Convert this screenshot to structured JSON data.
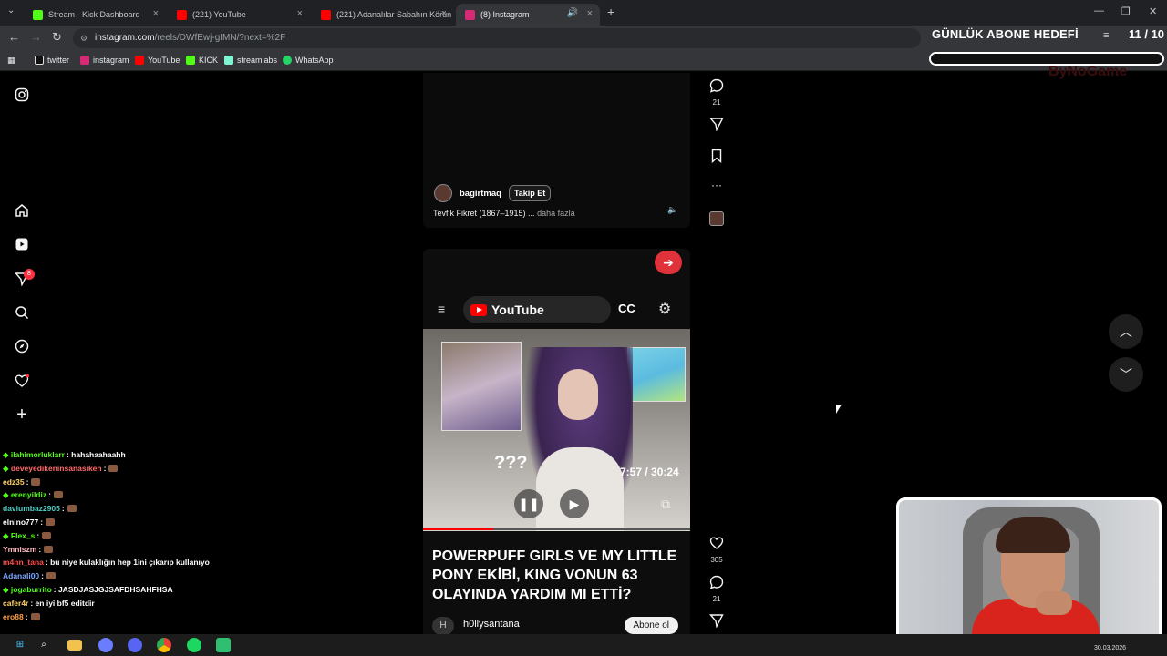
{
  "tabs": [
    {
      "label": "Stream - Kick Dashboard",
      "color": "#53fc18"
    },
    {
      "label": "(221) YouTube",
      "color": "#ff0000"
    },
    {
      "label": "(221) Adanalılar Sabahın Körün",
      "color": "#ff0000"
    },
    {
      "label": "(8) Instagram",
      "color": "#d62976"
    }
  ],
  "address": {
    "host": "instagram.com",
    "path": "/reels/DWfEwj-gIMN/?next=%2F"
  },
  "bookmarks": [
    {
      "label": "twitter",
      "color": "#ffffff"
    },
    {
      "label": "instagram",
      "color": "#d62976"
    },
    {
      "label": "YouTube",
      "color": "#ff0000"
    },
    {
      "label": "KICK",
      "color": "#53fc18"
    },
    {
      "label": "streamlabs",
      "color": "#80f5d2"
    },
    {
      "label": "WhatsApp",
      "color": "#25d366"
    }
  ],
  "overlay": {
    "goal_title": "GÜNLÜK ABONE HEDEFİ",
    "goal_count": "11 / 10",
    "brand": "ByNoGame"
  },
  "nav": {
    "notification_count": "8"
  },
  "reel1": {
    "username": "bagirtmaq",
    "follow": "Takip Et",
    "caption": "Tevfik Fikret (1867–1915) ...",
    "more": "daha fazla"
  },
  "reel2": {
    "yt_brand": "YouTube",
    "cc": "CC",
    "qmarks": "???",
    "time": "7:57 / 30:24",
    "progress": 0.262,
    "headline": "POWERPUFF GIRLS VE MY LITTLE PONY EKİBİ, KING VONUN 63 OLAYINDA YARDIM MI ETTİ?",
    "channel": "h0llysantana",
    "channel_initial": "H",
    "subscribe": "Abone ol"
  },
  "actions": {
    "comments_top": "21",
    "likes": "305",
    "comments_bottom": "21"
  },
  "chat": [
    {
      "user": "ilahimorluklarr",
      "color": "#53fc18",
      "msg": ": hahahaahaahh",
      "emote": false,
      "badge": true
    },
    {
      "user": "deveyedikeninsanasiken",
      "color": "#ff6b6b",
      "msg": ":",
      "emote": true,
      "badge": true
    },
    {
      "user": "edz35",
      "color": "#ffd166",
      "msg": ":",
      "emote": true,
      "badge": false
    },
    {
      "user": "erenyildiz",
      "color": "#53fc18",
      "msg": ":",
      "emote": true,
      "badge": true
    },
    {
      "user": "davlumbaz2905",
      "color": "#4ecdc4",
      "msg": ":",
      "emote": true,
      "badge": false
    },
    {
      "user": "elnino777",
      "color": "#ffffff",
      "msg": ":",
      "emote": true,
      "badge": false
    },
    {
      "user": "Flex_s",
      "color": "#53fc18",
      "msg": ":",
      "emote": true,
      "badge": true
    },
    {
      "user": "Ymniszm",
      "color": "#ffb6c1",
      "msg": ":",
      "emote": true,
      "badge": false
    },
    {
      "user": "m4nn_tana",
      "color": "#ff4d4d",
      "msg": ": bu niye kulaklığın hep 1ini çıkarıp kullanıyo",
      "emote": false,
      "badge": false
    },
    {
      "user": "Adanali00",
      "color": "#7aa7ff",
      "msg": ":",
      "emote": true,
      "badge": false
    },
    {
      "user": "jogaburrito",
      "color": "#53fc18",
      "msg": ": JASDJASJGJSAFDHSAHFHSA",
      "emote": false,
      "badge": true
    },
    {
      "user": "cafer4r",
      "color": "#ffd166",
      "msg": ": en iyi bf5 editdir",
      "emote": false,
      "badge": false
    },
    {
      "user": "ero88",
      "color": "#ff9f43",
      "msg": ":",
      "emote": true,
      "badge": false
    }
  ],
  "taskbar": {
    "date": "30.03.2026"
  }
}
